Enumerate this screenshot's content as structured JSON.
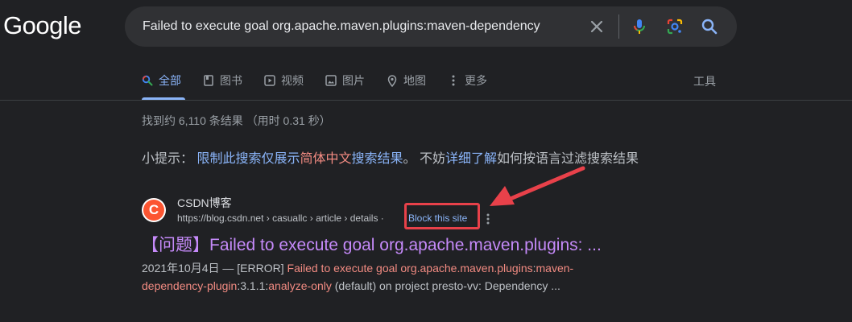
{
  "logo": "Google",
  "search": {
    "query": "Failed to execute goal org.apache.maven.plugins:maven-dependency"
  },
  "tabs": [
    {
      "label": "全部"
    },
    {
      "label": "图书"
    },
    {
      "label": "视频"
    },
    {
      "label": "图片"
    },
    {
      "label": "地图"
    },
    {
      "label": "更多"
    }
  ],
  "tools_label": "工具",
  "stats": "找到约 6,110 条结果 （用时 0.31 秒）",
  "tip": {
    "prefix": "小提示：",
    "link1a": "限制此搜索仅展示",
    "link1b": "简体中文",
    "link1c": "搜索结果",
    "mid": "。 不妨",
    "link2": "详细了解",
    "suffix": "如何按语言过滤搜索结果"
  },
  "result": {
    "favicon_letter": "C",
    "site_name": "CSDN博客",
    "url": "https://blog.csdn.net › casuallc › article › details ·",
    "block_label": "Block this site",
    "title": "【问题】Failed to execute goal org.apache.maven.plugins: ...",
    "snippet": {
      "date": "2021年10月4日 — ",
      "p1": "[ERROR] ",
      "h1": "Failed to execute goal org.apache.maven.plugins",
      "p2": ":",
      "h2": "maven-dependency-plugin",
      "p3": ":3.1.1:",
      "h3": "analyze-only",
      "p4": " (default) on project presto-vv: Dependency ..."
    }
  },
  "colors": {
    "accent": "#8ab4f8",
    "visited_title": "#c58af9",
    "highlight": "#f28b82",
    "annotation": "#e8414a"
  },
  "icons": [
    "clear-icon",
    "mic-icon",
    "lens-icon",
    "search-icon",
    "book-icon",
    "video-icon",
    "image-icon",
    "map-pin-icon",
    "more-vert-icon"
  ]
}
